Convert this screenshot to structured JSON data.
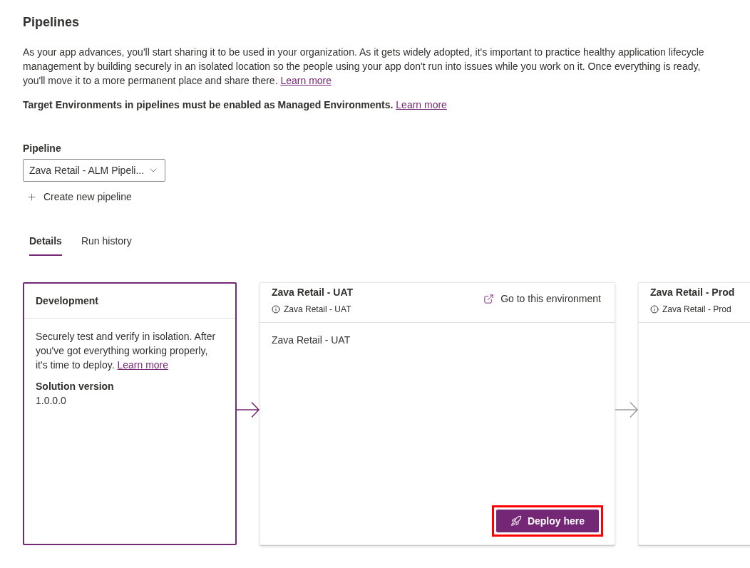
{
  "page": {
    "title": "Pipelines"
  },
  "intro": {
    "text": "As your app advances, you'll start sharing it to be used in your organization. As it gets widely adopted, it's important to practice healthy application lifecycle management by building securely in an isolated location so the people using your app don't run into issues while you work on it. Once everything is ready, you'll move it to a more permanent place and share there.",
    "link": "Learn more"
  },
  "notice": {
    "text": "Target Environments in pipelines must be enabled as Managed Environments.",
    "link": "Learn more"
  },
  "pipeline_picker": {
    "label": "Pipeline",
    "value": "Zava Retail - ALM Pipeli...",
    "create_action": "Create new pipeline"
  },
  "tabs": [
    {
      "label": "Details",
      "selected": true
    },
    {
      "label": "Run history",
      "selected": false
    }
  ],
  "stages": [
    {
      "kind": "source",
      "title": "Development",
      "active": true,
      "description": "Securely test and verify in isolation. After you've got everything working properly, it's time to deploy.",
      "link": "Learn more",
      "field_label": "Solution version",
      "field_value": "1.0.0.0"
    },
    {
      "kind": "target",
      "title": "Zava Retail - UAT",
      "active": false,
      "environment": "Zava Retail - UAT",
      "action_link": "Go to this environment",
      "body": "Zava Retail - UAT",
      "deploy": {
        "label": "Deploy here",
        "highlighted": true
      }
    },
    {
      "kind": "target",
      "title": "Zava Retail - Prod",
      "active": false,
      "environment": "Zava Retail - Prod"
    }
  ]
}
